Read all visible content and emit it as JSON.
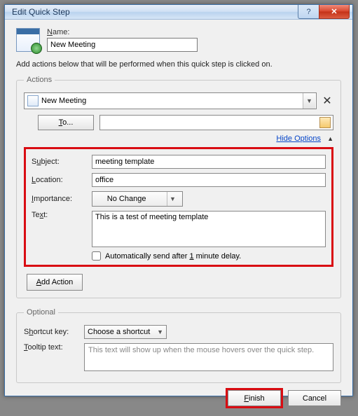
{
  "title": "Edit Quick Step",
  "name_label": "Name:",
  "name_value": "New Meeting",
  "instructions": "Add actions below that will be performed when this quick step is clicked on.",
  "actions_legend": "Actions",
  "action_selected": "New Meeting",
  "to_button": "To...",
  "hide_options": "Hide Options",
  "fields": {
    "subject_label": "Subject:",
    "subject_value": "meeting template",
    "location_label": "Location:",
    "location_value": "office",
    "importance_label": "Importance:",
    "importance_value": "No Change",
    "text_label": "Text:",
    "text_value": "This is a test of meeting template",
    "auto_send": "Automatically send after 1 minute delay."
  },
  "add_action": "Add Action",
  "optional_legend": "Optional",
  "shortcut_label": "Shortcut key:",
  "shortcut_value": "Choose a shortcut",
  "tooltip_label": "Tooltip text:",
  "tooltip_placeholder": "This text will show up when the mouse hovers over the quick step.",
  "finish": "Finish",
  "cancel": "Cancel"
}
